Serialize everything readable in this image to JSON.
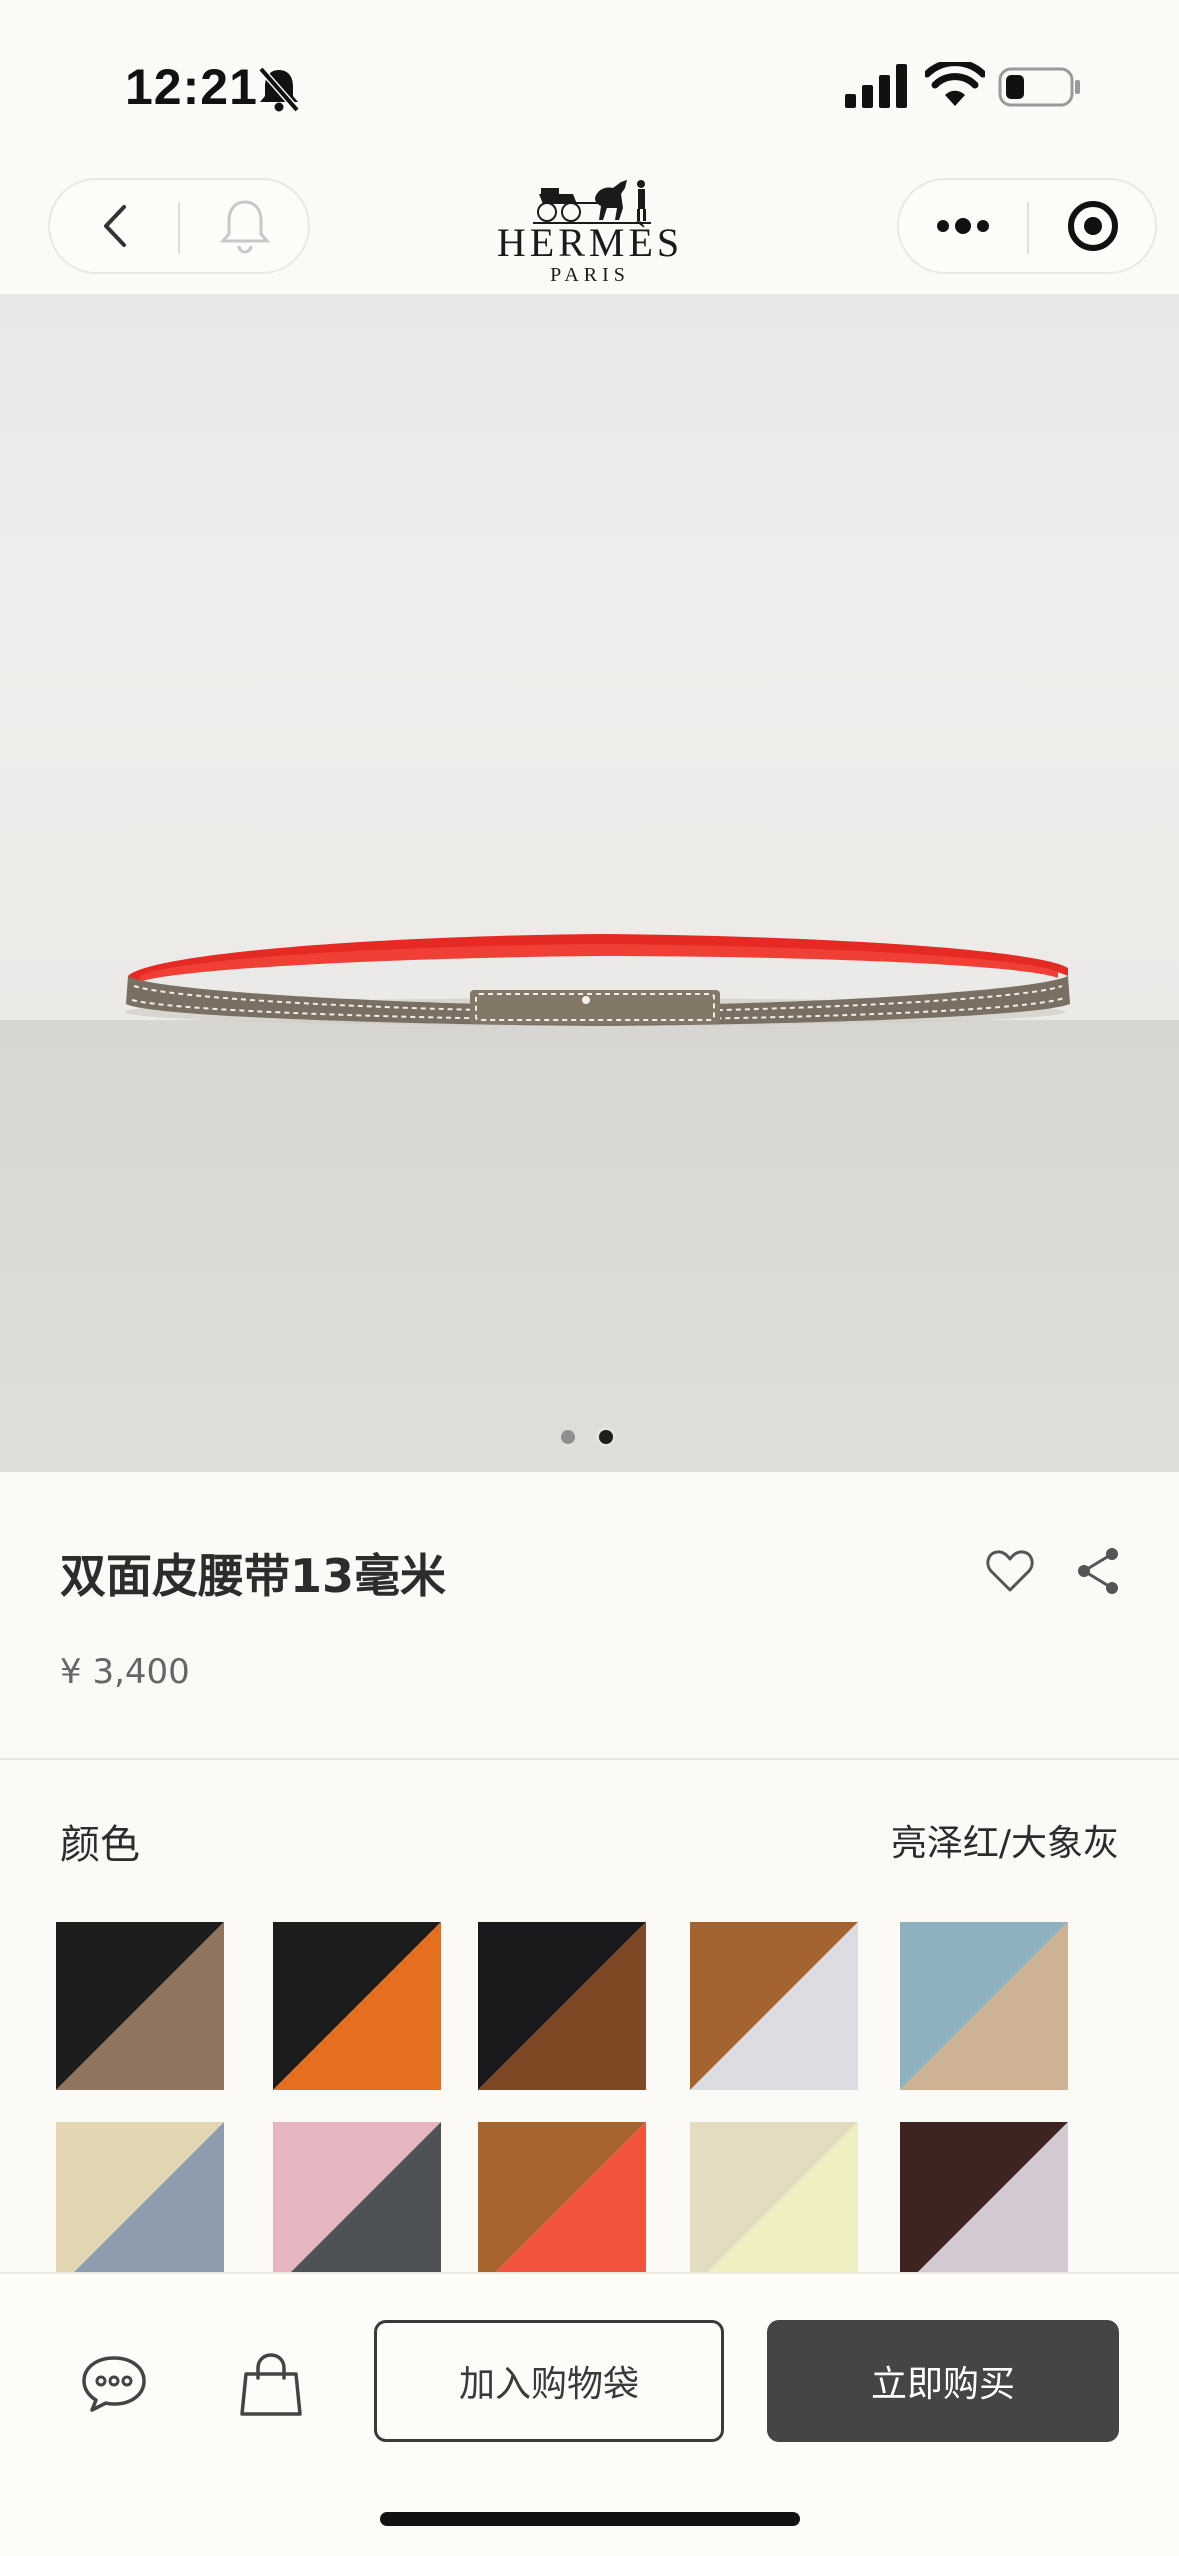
{
  "status_bar": {
    "time": "12:21",
    "icons": [
      "bell-off-icon",
      "signal-icon",
      "wifi-icon",
      "battery-icon"
    ]
  },
  "header": {
    "brand_name": "HERMÈS",
    "brand_subtitle": "PARIS",
    "left_buttons": [
      "back-icon",
      "bell-icon"
    ],
    "right_buttons": [
      "more-icon",
      "target-icon"
    ]
  },
  "gallery": {
    "page_count": 2,
    "active_index": 1
  },
  "product": {
    "title": "双面皮腰带13毫米",
    "price": "¥ 3,400"
  },
  "color_section": {
    "label": "颜色",
    "selected_value": "亮泽红/大象灰",
    "swatches": [
      {
        "name": "black-taupe",
        "color_a": "#1d1d1d",
        "color_b": "#8f7560"
      },
      {
        "name": "black-orange",
        "color_a": "#1c1c1c",
        "color_b": "#e4701f"
      },
      {
        "name": "black-brown",
        "color_a": "#1a1a1c",
        "color_b": "#7e4a25"
      },
      {
        "name": "gold-white",
        "color_a": "#a4622f",
        "color_b": "#dcdde1"
      },
      {
        "name": "blue-beige",
        "color_a": "#8eb1c0",
        "color_b": "#cdb293"
      },
      {
        "name": "cream-blue",
        "color_a": "#e3d7b3",
        "color_b": "#8d9cad"
      },
      {
        "name": "pink-grey",
        "color_a": "#e6b7c1",
        "color_b": "#4f5254"
      },
      {
        "name": "gold-red",
        "color_a": "#a8652e",
        "color_b": "#f1533d"
      },
      {
        "name": "cream-lemon",
        "color_a": "#e3dcc0",
        "color_b": "#f0efc2"
      },
      {
        "name": "chocolate-lilac",
        "color_a": "#3d2420",
        "color_b": "#d3cbd1"
      }
    ]
  },
  "bottom_bar": {
    "add_to_cart": "加入购物袋",
    "buy_now": "立即购买",
    "icons": [
      "chat-icon",
      "shopping-bag-icon"
    ]
  }
}
